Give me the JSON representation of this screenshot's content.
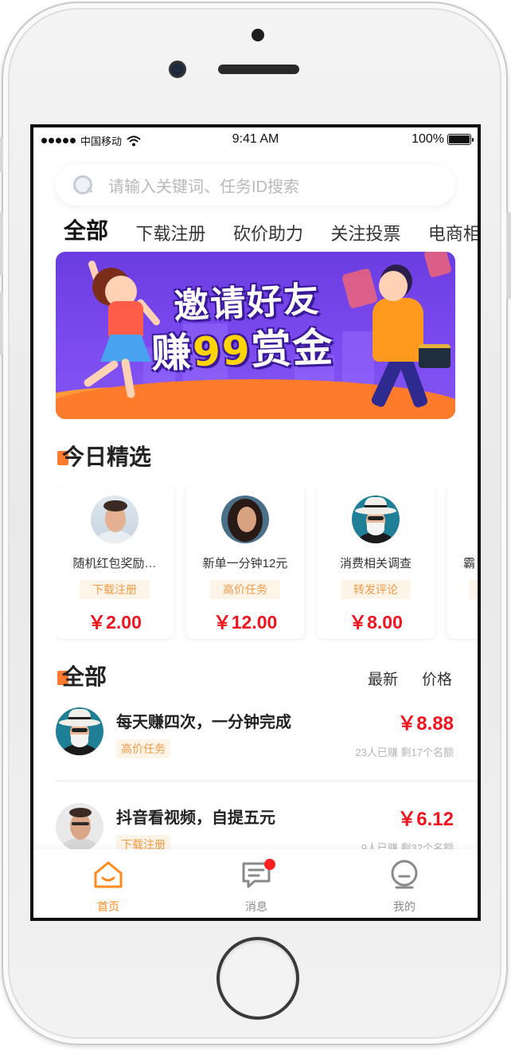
{
  "status_bar": {
    "carrier": "中国移动",
    "time": "9:41 AM",
    "battery": "100%"
  },
  "search": {
    "placeholder": "请输入关键词、任务ID搜索",
    "icon": "search-icon"
  },
  "tabs": [
    {
      "label": "全部",
      "active": true
    },
    {
      "label": "下载注册"
    },
    {
      "label": "砍价助力"
    },
    {
      "label": "关注投票"
    },
    {
      "label": "电商相"
    }
  ],
  "banner": {
    "line1": "邀请好友",
    "line2_prefix": "赚",
    "line2_number": "99",
    "line2_suffix": "赏金"
  },
  "featured": {
    "title": "今日精选",
    "cards": [
      {
        "title": "随机红包奖励…",
        "tag": "下载注册",
        "price": "￥2.00"
      },
      {
        "title": "新单一分钟12元",
        "tag": "高价任务",
        "price": "￥12.00"
      },
      {
        "title": "消费相关调查",
        "tag": "转发评论",
        "price": "￥8.00"
      },
      {
        "title": "霸",
        "tag": "",
        "price": ""
      }
    ]
  },
  "all": {
    "title": "全部",
    "sort_newest": "最新",
    "sort_price": "价格",
    "rows": [
      {
        "title": "每天赚四次，一分钟完成",
        "tag": "高价任务",
        "price": "￥8.88",
        "meta": "23人已赚 剩17个名额"
      },
      {
        "title": "抖音看视频，自提五元",
        "tag": "下载注册",
        "price": "￥6.12",
        "meta": "9人已赚 剩32个名额"
      }
    ]
  },
  "tabbar": {
    "home": "首页",
    "messages": "消息",
    "mine": "我的"
  },
  "colors": {
    "accent": "#ff8a1f",
    "price": "#f0141e",
    "tag_text": "#f39a45",
    "tag_bg": "#fff4e8",
    "banner_purple": "#7d4bf0",
    "badge": "#ff1f1f"
  }
}
